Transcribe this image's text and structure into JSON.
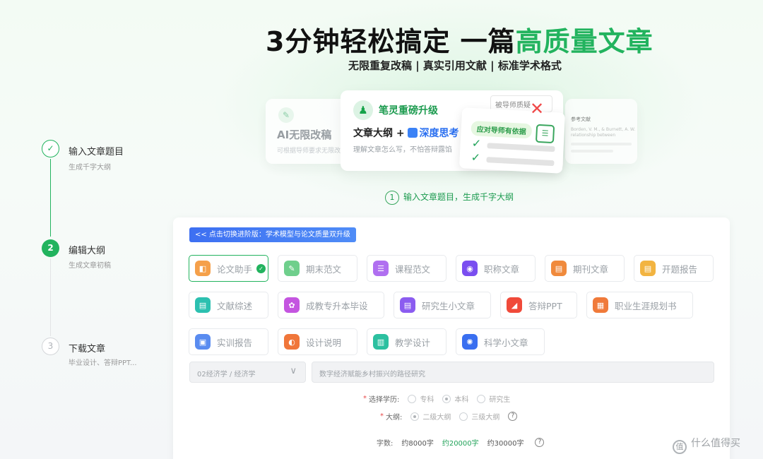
{
  "hero": {
    "title_prefix": "3分钟轻松搞定 一篇",
    "title_highlight": "高质量文章",
    "subtitle": "无限重复改稿 | 真实引用文献 | 标准学术格式"
  },
  "features": {
    "left": {
      "title": "AI无限改稿",
      "desc": "可根据导师要求无限改"
    },
    "main": {
      "badge": "笔灵重磅升级",
      "line_prefix": "文章大纲 + ",
      "line_deep": "深度思考",
      "desc": "理解文章怎么写，不怕答辩露馅"
    },
    "review_tag": "被导师质疑",
    "evidence_tag": "应对导师有依据",
    "ref": {
      "title": "参考文献",
      "text": "Borden, V. M., & Burnett, A. W. relationship between college..."
    }
  },
  "step_caption": {
    "num": "1",
    "text": "输入文章题目，生成千字大纲"
  },
  "stepper": [
    {
      "num": "✓",
      "title": "输入文章题目",
      "sub": "生成千字大纲"
    },
    {
      "num": "2",
      "title": "编辑大纲",
      "sub": "生成文章初稿"
    },
    {
      "num": "3",
      "title": "下载文章",
      "sub": "毕业设计、答辩PPT..."
    }
  ],
  "switch_button": "<< 点击切换进阶版：学术模型与论文质量双升级",
  "categories": [
    {
      "label": "论文助手",
      "color": "#f5a04a",
      "glyph": "◧"
    },
    {
      "label": "期末范文",
      "color": "#6fcf8c",
      "glyph": "✎"
    },
    {
      "label": "课程范文",
      "color": "#b06ff0",
      "glyph": "☰"
    },
    {
      "label": "职称文章",
      "color": "#7a4ef0",
      "glyph": "◉"
    },
    {
      "label": "期刊文章",
      "color": "#f08a3c",
      "glyph": "▤"
    },
    {
      "label": "开题报告",
      "color": "#f2b441",
      "glyph": "▤"
    },
    {
      "label": "文献综述",
      "color": "#2cc0b0",
      "glyph": "▤"
    },
    {
      "label": "成教专升本毕设",
      "color": "#c455e0",
      "glyph": "✿"
    },
    {
      "label": "研究生小文章",
      "color": "#8b5cf0",
      "glyph": "▤"
    },
    {
      "label": "答辩PPT",
      "color": "#f04a3a",
      "glyph": "◢"
    },
    {
      "label": "职业生涯规划书",
      "color": "#f07a3a",
      "glyph": "▦"
    },
    {
      "label": "实训报告",
      "color": "#5a8cf0",
      "glyph": "▣"
    },
    {
      "label": "设计说明",
      "color": "#f0763a",
      "glyph": "◐"
    },
    {
      "label": "教学设计",
      "color": "#2cc0a0",
      "glyph": "▥"
    },
    {
      "label": "科学小文章",
      "color": "#3a6ff0",
      "glyph": "✺"
    }
  ],
  "form": {
    "discipline": "02经济学 / 经济学",
    "topic_placeholder": "数字经济赋能乡村振兴的路径研究",
    "education": {
      "label": "选择学历:",
      "options": [
        "专科",
        "本科",
        "研究生"
      ],
      "selected": "本科"
    },
    "outline": {
      "label": "大纲:",
      "options": [
        "二级大纲",
        "三级大纲"
      ],
      "selected": "二级大纲"
    },
    "wordcount": {
      "label": "字数:",
      "options": [
        "约8000字",
        "约20000字",
        "约30000字"
      ],
      "selected": "约20000字"
    },
    "help": "?"
  },
  "watermark": {
    "icon": "值",
    "text": "什么值得买"
  }
}
